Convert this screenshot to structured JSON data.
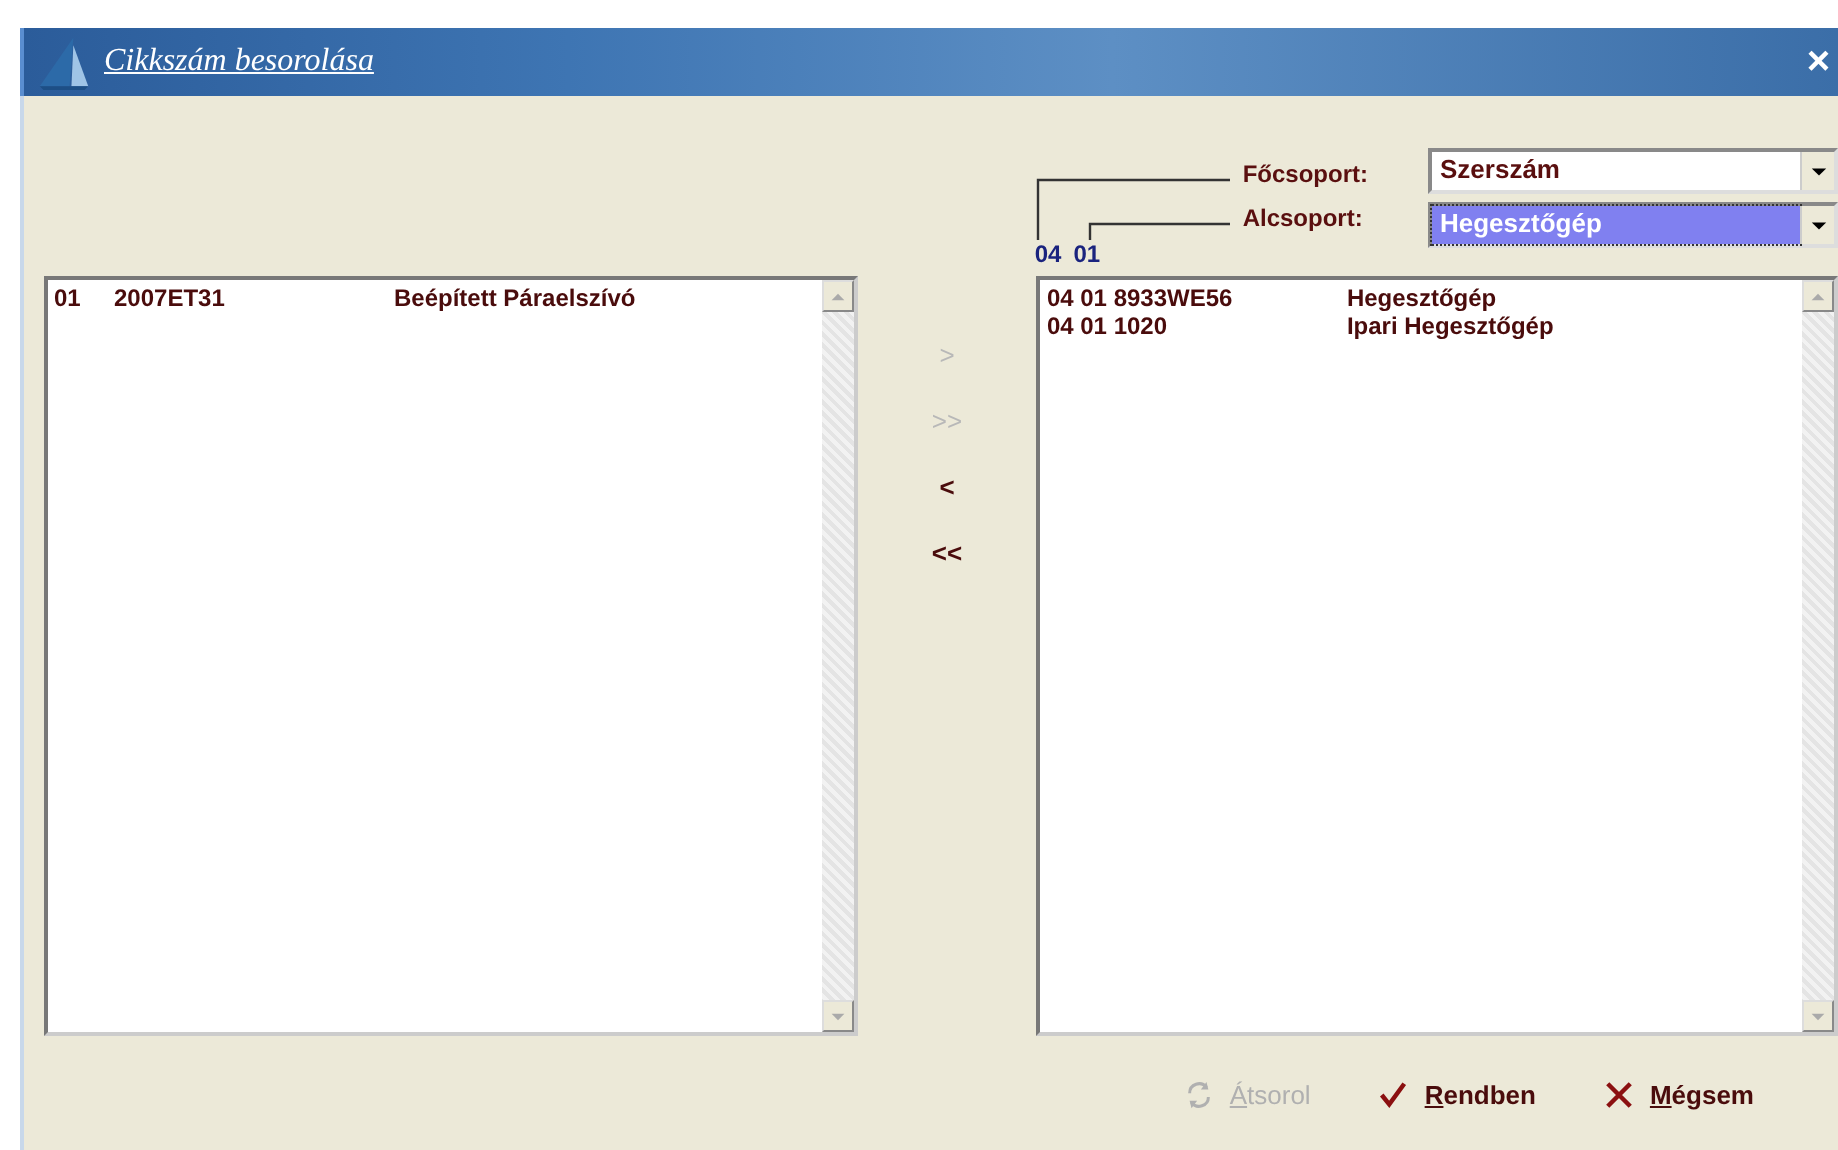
{
  "window": {
    "title": "Cikkszám besorolása",
    "close": "×"
  },
  "left_list": {
    "rows": [
      {
        "cells": [
          "01",
          "2007ET31",
          "Beépített Páraelszívó"
        ]
      }
    ]
  },
  "move_buttons": [
    {
      "label": ">",
      "disabled": true
    },
    {
      "label": ">>",
      "disabled": true
    },
    {
      "label": "<",
      "disabled": false
    },
    {
      "label": "<<",
      "disabled": false
    }
  ],
  "groups": [
    {
      "label": "Főcsoport:",
      "value": "Szerszám",
      "code": "04",
      "focused": false
    },
    {
      "label": "Alcsoport:",
      "value": "Hegesztőgép",
      "code": "01",
      "focused": true
    }
  ],
  "right_list": {
    "rows": [
      {
        "cells": [
          "04 01 8933WE56",
          "Hegesztőgép"
        ]
      },
      {
        "cells": [
          "04 01 1020",
          "Ipari Hegesztőgép"
        ]
      }
    ]
  },
  "buttons": [
    {
      "kind": "reorder",
      "label": "Átsorol",
      "disabled": true
    },
    {
      "kind": "ok",
      "label": "Rendben",
      "disabled": false
    },
    {
      "kind": "cancel",
      "label": "Mégsem",
      "disabled": false
    }
  ]
}
